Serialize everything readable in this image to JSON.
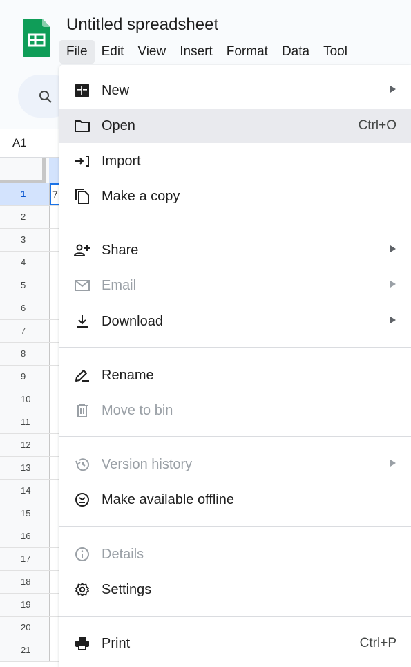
{
  "doc": {
    "title": "Untitled spreadsheet"
  },
  "menubar": {
    "items": [
      {
        "label": "File",
        "active": true
      },
      {
        "label": "Edit"
      },
      {
        "label": "View"
      },
      {
        "label": "Insert"
      },
      {
        "label": "Format"
      },
      {
        "label": "Data"
      },
      {
        "label": "Tool"
      }
    ]
  },
  "namebox": {
    "value": "A1"
  },
  "grid": {
    "rows": [
      "1",
      "2",
      "3",
      "4",
      "5",
      "6",
      "7",
      "8",
      "9",
      "10",
      "11",
      "12",
      "13",
      "14",
      "15",
      "16",
      "17",
      "18",
      "19",
      "20",
      "21"
    ],
    "cell_a1": "7"
  },
  "file_menu": {
    "new": {
      "label": "New",
      "icon": "new-sheet-icon",
      "submenu": true
    },
    "open": {
      "label": "Open",
      "shortcut": "Ctrl+O",
      "icon": "folder-icon"
    },
    "import": {
      "label": "Import",
      "icon": "import-icon"
    },
    "copy": {
      "label": "Make a copy",
      "icon": "copy-icon"
    },
    "share": {
      "label": "Share",
      "icon": "share-icon",
      "submenu": true
    },
    "email": {
      "label": "Email",
      "icon": "email-icon",
      "submenu": true,
      "disabled": true
    },
    "download": {
      "label": "Download",
      "icon": "download-icon",
      "submenu": true
    },
    "rename": {
      "label": "Rename",
      "icon": "rename-icon"
    },
    "bin": {
      "label": "Move to bin",
      "icon": "trash-icon",
      "disabled": true
    },
    "version": {
      "label": "Version history",
      "icon": "history-icon",
      "submenu": true,
      "disabled": true
    },
    "offline": {
      "label": "Make available offline",
      "icon": "offline-icon"
    },
    "details": {
      "label": "Details",
      "icon": "info-icon",
      "disabled": true
    },
    "settings": {
      "label": "Settings",
      "icon": "gear-icon"
    },
    "print": {
      "label": "Print",
      "shortcut": "Ctrl+P",
      "icon": "printer-icon"
    }
  },
  "colors": {
    "brand_green": "#0f9d58",
    "selection_blue": "#1a73e8",
    "disabled_text": "#9aa0a6",
    "hover_bg": "#e9eaee"
  }
}
